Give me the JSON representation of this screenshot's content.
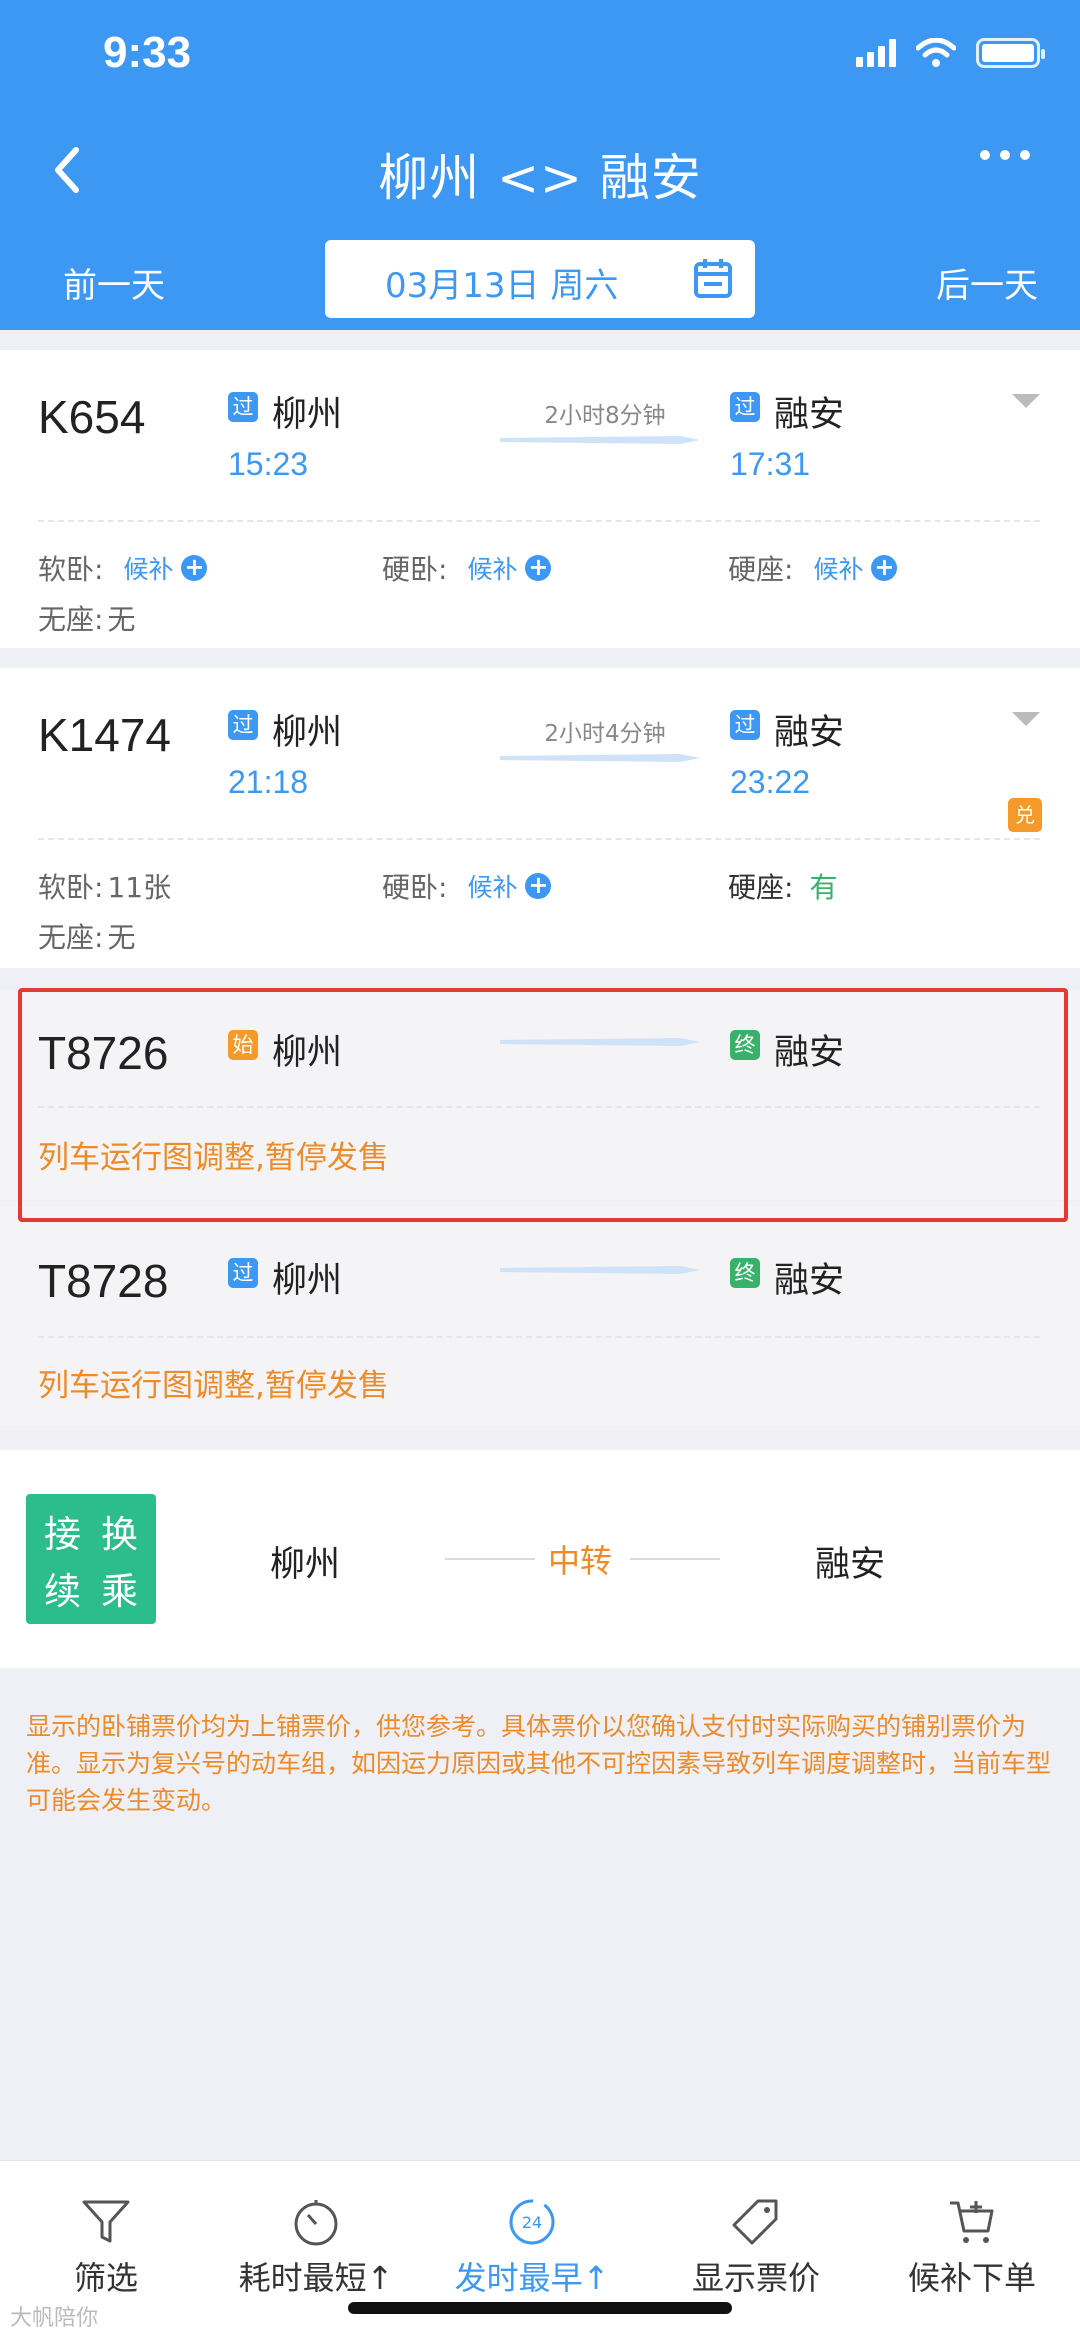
{
  "status_bar": {
    "time": "9:33"
  },
  "header": {
    "title": "柳州 <> 融安",
    "prev_day": "前一天",
    "next_day": "后一天",
    "date": "03月13日 周六"
  },
  "trains": [
    {
      "number": "K654",
      "from_badge": "过",
      "from": "柳州",
      "depart": "15:23",
      "duration": "2小时8分钟",
      "to_badge": "过",
      "to": "融安",
      "arrive": "17:31",
      "seats": [
        {
          "label": "软卧:",
          "value": "候补"
        },
        {
          "label": "硬卧:",
          "value": "候补"
        },
        {
          "label": "硬座:",
          "value": "候补"
        },
        {
          "label": "无座:",
          "value": "无"
        }
      ]
    },
    {
      "number": "K1474",
      "from_badge": "过",
      "from": "柳州",
      "depart": "21:18",
      "duration": "2小时4分钟",
      "to_badge": "过",
      "to": "融安",
      "arrive": "23:22",
      "exchange_badge": "兑",
      "seats": [
        {
          "label": "软卧:",
          "value": "11张"
        },
        {
          "label": "硬卧:",
          "value": "候补"
        },
        {
          "label": "硬座:",
          "value": "有"
        },
        {
          "label": "无座:",
          "value": "无"
        }
      ]
    },
    {
      "number": "T8726",
      "from_badge": "始",
      "from": "柳州",
      "to_badge": "终",
      "to": "融安",
      "notice": "列车运行图调整,暂停发售"
    },
    {
      "number": "T8728",
      "from_badge": "过",
      "from": "柳州",
      "to_badge": "终",
      "to": "融安",
      "notice": "列车运行图调整,暂停发售"
    }
  ],
  "transfer": {
    "logo_chars": [
      "接",
      "换",
      "续",
      "乘"
    ],
    "from": "柳州",
    "middle": "中转",
    "to": "融安"
  },
  "note": "显示的卧铺票价均为上铺票价，供您参考。具体票价以您确认支付时实际购买的铺别票价为准。显示为复兴号的动车组，如因运力原因或其他不可控因素导致列车调度调整时，当前车型可能会发生变动。",
  "tabbar": {
    "tabs": [
      {
        "label": "筛选",
        "icon": "filter-icon"
      },
      {
        "label": "耗时最短↑",
        "icon": "timer-icon"
      },
      {
        "label": "发时最早↑",
        "icon": "clock-24-icon",
        "active": true
      },
      {
        "label": "显示票价",
        "icon": "price-tag-icon"
      },
      {
        "label": "候补下单",
        "icon": "cart-icon"
      }
    ],
    "clock_number": "24"
  },
  "colors": {
    "primary": "#3d98f3",
    "orange": "#ee8b28",
    "green": "#38b26a",
    "highlight": "#e53935"
  },
  "watermark": "大帆陪你"
}
